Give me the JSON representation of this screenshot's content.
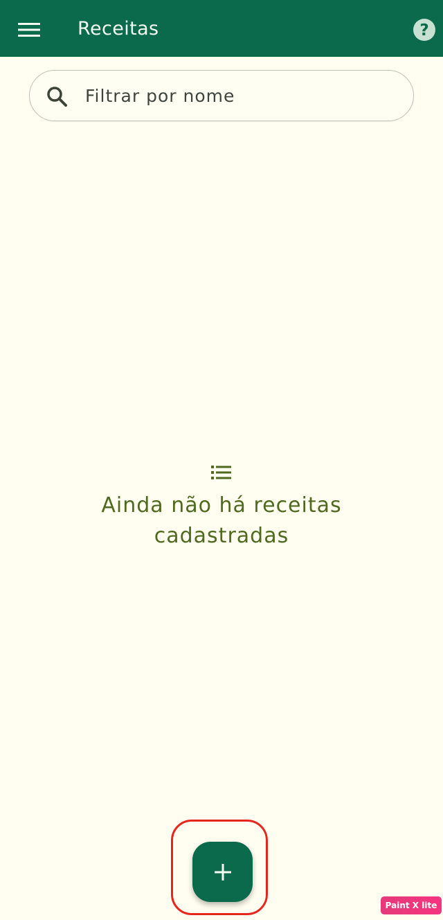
{
  "app_bar": {
    "title": "Receitas",
    "menu_icon": "menu-icon",
    "help_icon": "help-circle-icon"
  },
  "search": {
    "placeholder": "Filtrar por nome",
    "value": "",
    "icon": "search-icon"
  },
  "empty_state": {
    "icon": "list-icon",
    "message": "Ainda não há receitas cadastradas"
  },
  "fab": {
    "icon": "plus-icon",
    "highlight_color": "#E5261C"
  },
  "watermark": {
    "text": "Paint X lite"
  },
  "colors": {
    "primary": "#0C6A4C",
    "background": "#FFFEF0",
    "empty_text": "#4F6A1E"
  }
}
